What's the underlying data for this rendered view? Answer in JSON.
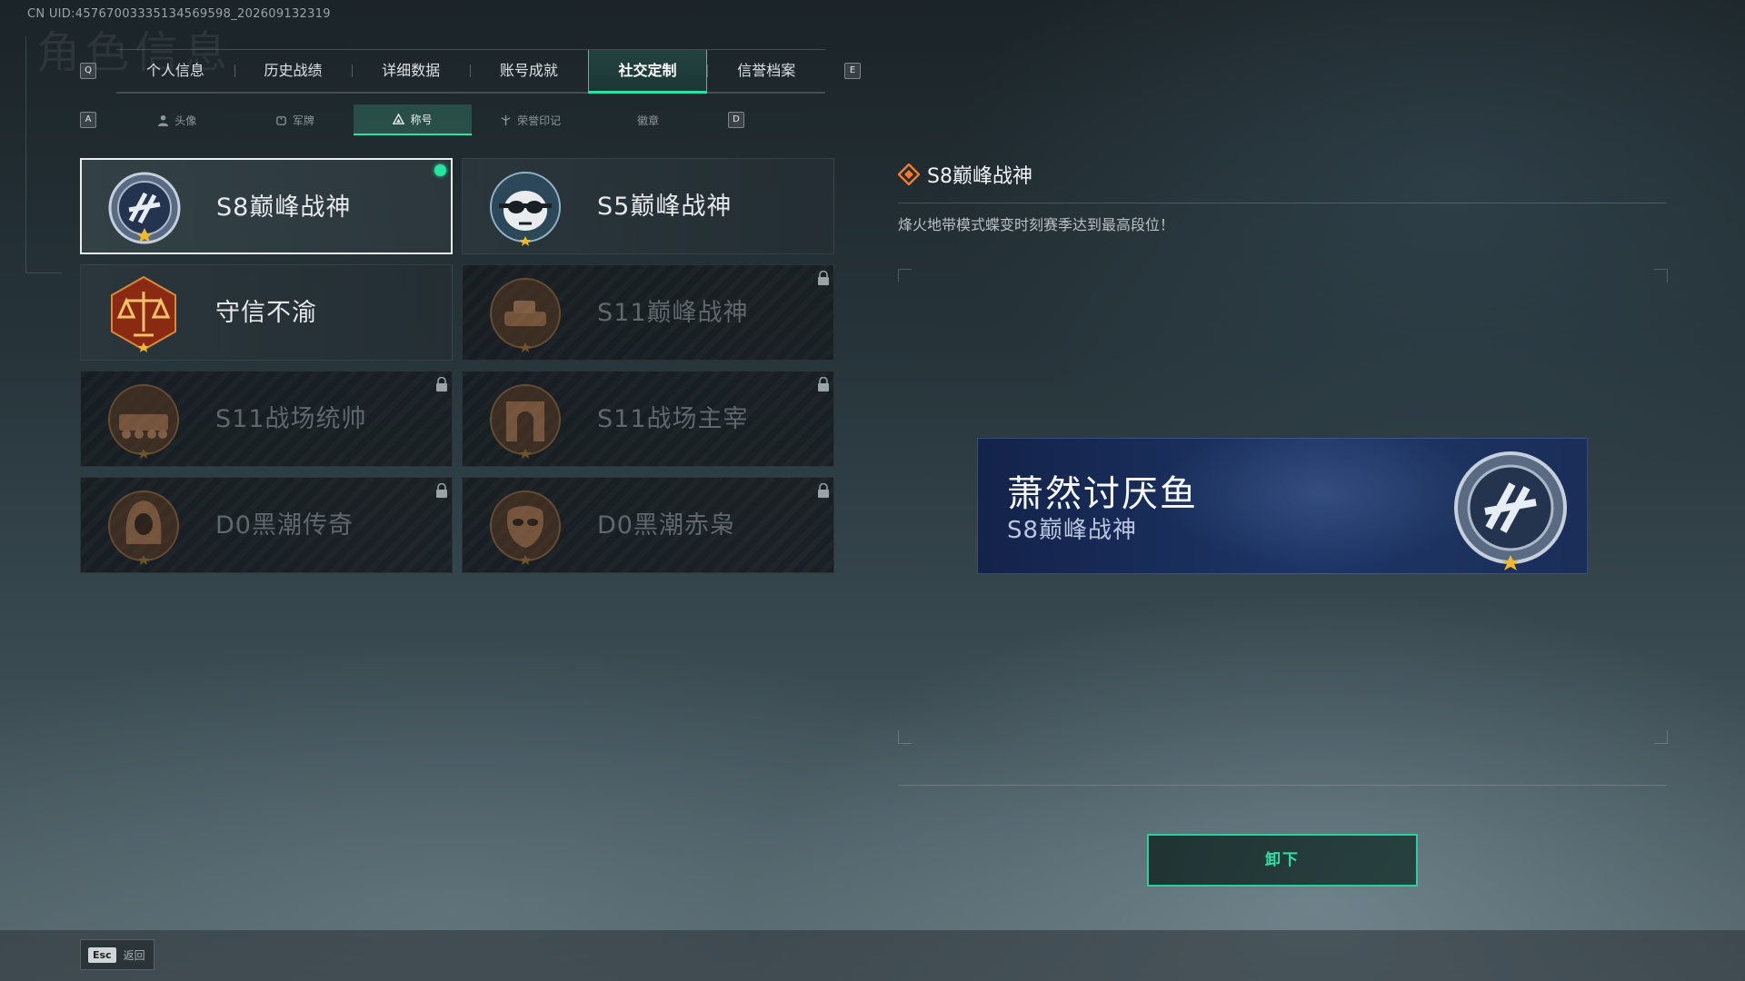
{
  "header": {
    "uid": "CN UID:45767003335134569598_202609132319",
    "bg_title": "角色信息",
    "key_left": "Q",
    "key_right": "E"
  },
  "main_tabs": [
    {
      "label": "个人信息",
      "active": false
    },
    {
      "label": "历史战绩",
      "active": false
    },
    {
      "label": "详细数据",
      "active": false
    },
    {
      "label": "账号成就",
      "active": false
    },
    {
      "label": "社交定制",
      "active": true
    },
    {
      "label": "信誉档案",
      "active": false
    }
  ],
  "sub_tabs": {
    "key_left": "A",
    "key_right": "D",
    "items": [
      {
        "label": "头像",
        "icon": "person-icon",
        "active": false
      },
      {
        "label": "军牌",
        "icon": "dogtag-icon",
        "active": false
      },
      {
        "label": "称号",
        "icon": "title-triangle-icon",
        "active": true
      },
      {
        "label": "荣誉印记",
        "icon": "honor-mark-icon",
        "active": false
      },
      {
        "label": "徽章",
        "icon": "",
        "active": false
      }
    ]
  },
  "titles": [
    {
      "name": "S8巅峰战神",
      "badge": "s8-peak-badge-icon",
      "locked": false,
      "selected": true,
      "equipped": true
    },
    {
      "name": "S5巅峰战神",
      "badge": "skull-goggles-badge-icon",
      "locked": false,
      "selected": false,
      "equipped": false
    },
    {
      "name": "守信不渝",
      "badge": "scales-badge-icon",
      "locked": false,
      "selected": false,
      "equipped": false
    },
    {
      "name": "S11巅峰战神",
      "badge": "tank-badge-icon",
      "locked": true,
      "selected": false,
      "equipped": false
    },
    {
      "name": "S11战场统帅",
      "badge": "armored-vehicle-badge-icon",
      "locked": true,
      "selected": false,
      "equipped": false
    },
    {
      "name": "S11战场主宰",
      "badge": "arch-badge-icon",
      "locked": true,
      "selected": false,
      "equipped": false
    },
    {
      "name": "D0黑潮传奇",
      "badge": "hooded-figure-badge-icon",
      "locked": true,
      "selected": false,
      "equipped": false
    },
    {
      "name": "D0黑潮赤枭",
      "badge": "mask-badge-icon",
      "locked": true,
      "selected": false,
      "equipped": false
    }
  ],
  "detail": {
    "title": "S8巅峰战神",
    "description": "烽火地带模式蝶变时刻赛季达到最高段位！"
  },
  "nameplate": {
    "player_name": "萧然讨厌鱼",
    "title": "S8巅峰战神"
  },
  "actions": {
    "unequip_label": "卸下"
  },
  "footer": {
    "esc_key": "Esc",
    "back_label": "返回"
  },
  "colors": {
    "accent": "#2ee0a8",
    "equipped_dot": "#25e6a0",
    "nameplate_bg": "#1d3566"
  }
}
